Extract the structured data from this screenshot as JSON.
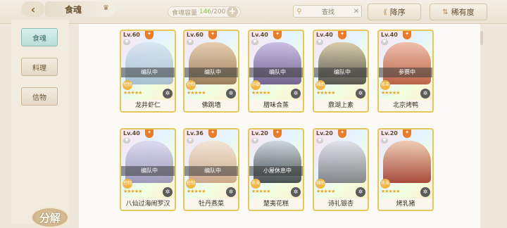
{
  "header": {
    "tab_title": "食魂",
    "capacity_label": "食魂容量",
    "capacity_current": "146",
    "capacity_total": "/200",
    "search_placeholder": "查找",
    "sort_desc_label": "降序",
    "sort_rarity_label": "稀有度"
  },
  "sidebar": {
    "items": [
      {
        "label": "食魂",
        "active": true
      },
      {
        "label": "料理",
        "active": false
      },
      {
        "label": "信物",
        "active": false
      }
    ],
    "decompose_label": "分解"
  },
  "cards": [
    {
      "level": "Lv.60",
      "status": "编队中",
      "role": "控制",
      "name": "龙井虾仁",
      "stars": "★★★★★",
      "portrait_colors": [
        "#d7e5f0",
        "#9bb6c9"
      ]
    },
    {
      "level": "Lv.60",
      "status": "编队中",
      "role": "控制",
      "name": "佛跳墙",
      "stars": "★★★★★",
      "portrait_colors": [
        "#e8c8a4",
        "#8c6a44"
      ]
    },
    {
      "level": "Lv.40",
      "status": "编队中",
      "role": "防御",
      "name": "腊味合蒸",
      "stars": "★★★★★",
      "portrait_colors": [
        "#c7b6e2",
        "#5b4a7e"
      ]
    },
    {
      "level": "Lv.40",
      "status": "编队中",
      "role": "辅助",
      "name": "鼎湖上素",
      "stars": "★★★★★",
      "portrait_colors": [
        "#d8c79c",
        "#3b3a36"
      ]
    },
    {
      "level": "Lv.40",
      "status": "参赛中",
      "role": "攻击",
      "name": "北京烤鸭",
      "stars": "★★★★★",
      "portrait_colors": [
        "#f0b7a0",
        "#b14a2c"
      ]
    },
    {
      "level": "Lv.40",
      "status": "编队中",
      "role": "控制",
      "name": "八仙过海闹罗汉",
      "stars": "★★★★★",
      "portrait_colors": [
        "#dcd7ee",
        "#8f8ab2"
      ]
    },
    {
      "level": "Lv.36",
      "status": "编队中",
      "role": "控制",
      "name": "牡丹燕菜",
      "stars": "★★★★★",
      "portrait_colors": [
        "#f3e3cf",
        "#c59b7a"
      ]
    },
    {
      "level": "Lv.20",
      "status": "小屋休息中",
      "role": "攻击",
      "name": "楚夷花糕",
      "stars": "★★★★★",
      "portrait_colors": [
        "#c9d2d8",
        "#2c3136"
      ]
    },
    {
      "level": "Lv.20",
      "status": "",
      "role": "辅助",
      "name": "诗礼银杏",
      "stars": "★★★★★",
      "portrait_colors": [
        "#dfe1e6",
        "#6f7178"
      ]
    },
    {
      "level": "Lv.20",
      "status": "",
      "role": "攻击",
      "name": "烤乳猪",
      "stars": "★★★★★",
      "portrait_colors": [
        "#f1c6a8",
        "#9a2d1e"
      ]
    }
  ]
}
